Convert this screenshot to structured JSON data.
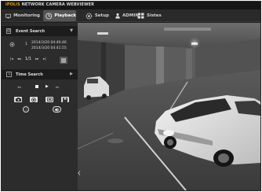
{
  "header": {
    "brand_prefix": "iPOLiS",
    "brand_title": "NETWORK CAMERA WEBVIEWER"
  },
  "tabs": [
    {
      "label": "Monitoring",
      "icon": "monitor-icon",
      "active": false
    },
    {
      "label": "Playback",
      "icon": "playback-icon",
      "active": true
    },
    {
      "label": "Setup",
      "icon": "gear-icon",
      "active": false
    },
    {
      "label": "ADMIN",
      "icon": "user-icon",
      "active": false
    },
    {
      "label": "Sistes",
      "icon": "sites-icon",
      "active": false
    }
  ],
  "event_search": {
    "title": "Event Search",
    "expand_icon": "chevron-down-icon",
    "result_icon": "gear-icon",
    "result_count": "1",
    "start_time": "2014/3/20 04:40:46",
    "end_time": "2014/3/20 04:41:55",
    "page": "1/1",
    "prev_icon": "skip-back-icon",
    "rewind_icon": "rewind-icon",
    "forward_icon": "forward-icon",
    "next_icon": "skip-forward-icon",
    "list_icon": "list-icon"
  },
  "time_search": {
    "title": "Time Search",
    "expand_icon": "chevron-right-icon"
  },
  "playback_controls": [
    "rewind-icon",
    "stop-icon",
    "play-icon",
    "forward-icon"
  ],
  "tools": [
    "camera-icon",
    "record-icon",
    "screen-icon",
    "save-icon"
  ],
  "bottom_buttons": [
    "info-icon",
    "audio-icon"
  ],
  "video": {
    "scene": "parking-garage-camera-view",
    "collapse_icon": "chevron-left-icon"
  }
}
